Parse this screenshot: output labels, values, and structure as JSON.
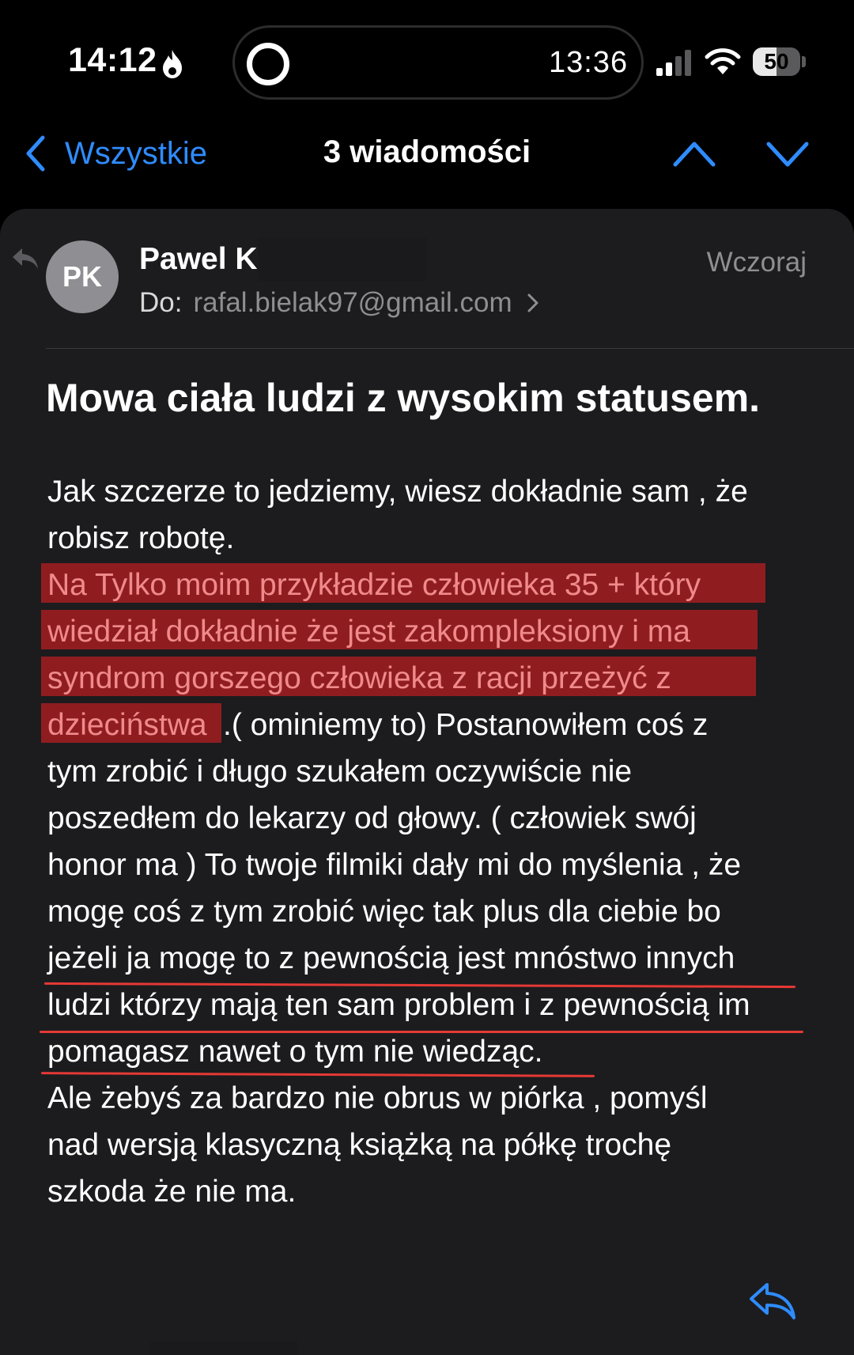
{
  "status_bar": {
    "time": "14:12",
    "island_time": "13:36",
    "battery": "50",
    "battery_level": 0.5
  },
  "nav": {
    "back_label": "Wszystkie",
    "title": "3 wiadomości"
  },
  "message": {
    "avatar_initials": "PK",
    "sender": "Pawel K",
    "date": "Wczoraj",
    "to_label": "Do:",
    "to_address": "rafal.bielak97@gmail.com",
    "subject": "Mowa ciała ludzi z wysokim statusem.",
    "body_lines": [
      "Jak szczerze to jedziemy, wiesz dokładnie sam , że",
      "robisz robotę.",
      "Na Tylko moim przykładzie człowieka 35 + który",
      "wiedział dokładnie że jest zakompleksiony i ma",
      "syndrom gorszego człowieka z racji przeżyć z",
      "dzieciństwa",
      " .( ominiemy to) Postanowiłem coś z",
      "tym zrobić i długo szukałem oczywiście nie",
      "poszedłem do lekarzy od głowy. ( człowiek swój",
      "honor ma ) To twoje filmiki dały mi do myślenia , że",
      "mogę coś z tym zrobić więc tak plus dla ciebie bo",
      "jeżeli ja mogę to z pewnością jest mnóstwo innych",
      "ludzi którzy mają ten sam problem i z pewnością im",
      "pomagasz nawet o tym nie wiedząc.",
      "Ale żebyś za bardzo nie obrus w piórka , pomyśl",
      "nad wersją klasyczną książką na półkę trochę",
      "szkoda że nie ma."
    ]
  },
  "colors": {
    "accent": "#2f8cff",
    "highlight_bg": "#8f1d20",
    "highlight_text": "#f08a8a",
    "underline": "#e53935",
    "card_bg": "#1c1c1e"
  },
  "icons": {
    "status": [
      "flame-icon",
      "signal-icon",
      "wifi-icon"
    ],
    "nav": [
      "chevron-left-icon",
      "chevron-up-icon",
      "chevron-down-icon"
    ],
    "message": [
      "reply-arrow-icon",
      "chevron-right-icon",
      "reply-icon"
    ]
  }
}
